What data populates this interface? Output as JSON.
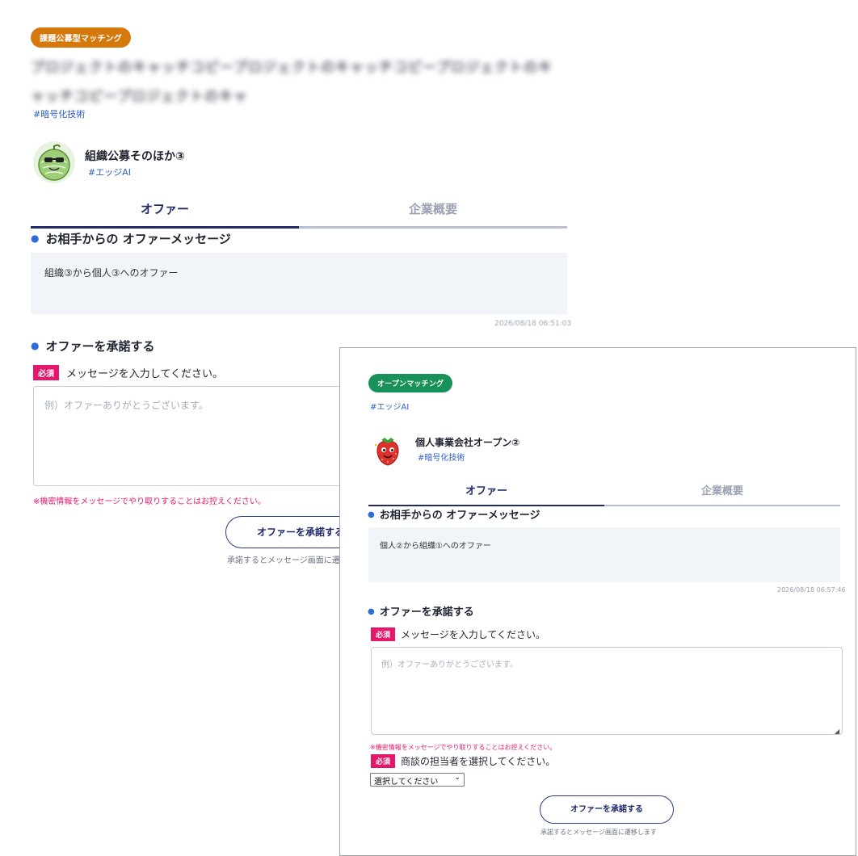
{
  "back": {
    "badge": "課題公募型マッチング",
    "blurred_title": "プロジェクトのキャッチコピープロジェクトのキャッチコピープロジェクトのキャッチコピープロジェクトのキャ",
    "tag": "#暗号化技術",
    "org_name": "組織公募そのほか③",
    "org_tag": "#エッジAI",
    "tabs": [
      "オファー",
      "企業概要"
    ],
    "section_message": "お相手からの オファーメッセージ",
    "message": "組織③から個人③へのオファー",
    "timestamp": "2026/08/18 06:51:03",
    "section_accept": "オファーを承諾する",
    "required": "必須",
    "input_label": "メッセージを入力してください。",
    "input_placeholder": "例）オファーありがとうございます。",
    "warning": "※機密情報をメッセージでやり取りすることはお控えください。",
    "accept_button": "オファーを承諾する",
    "accept_note": "承諾するとメッセージ画面に遷"
  },
  "front": {
    "badge": "オープンマッチング",
    "tag": "#エッジAI",
    "org_name": "個人事業会社オープン②",
    "org_tag": "#暗号化技術",
    "tabs": [
      "オファー",
      "企業概要"
    ],
    "section_message": "お相手からの オファーメッセージ",
    "message": "個人②から組織①へのオファー",
    "timestamp": "2026/08/18 06:57:46",
    "section_accept": "オファーを承諾する",
    "required": "必須",
    "input_label": "メッセージを入力してください。",
    "input_placeholder": "例）オファーありがとうございます。",
    "warning": "※機密情報をメッセージでやり取りすることはお控えください。",
    "select_label": "商談の担当者を選択してください。",
    "select_value": "選択してください",
    "accept_button": "オファーを承諾する",
    "accept_note": "承諾するとメッセージ画面に遷移します"
  },
  "colors": {
    "badge_orange": "#d6790c",
    "badge_green": "#19925a",
    "navy": "#1f2a6b",
    "link_blue": "#2b5cc9",
    "required_pink": "#e5176c"
  },
  "icons": [
    "melon-mascot-avatar-icon",
    "strawberry-mascot-avatar-icon",
    "chevron-down-icon",
    "bullet-dot-icon",
    "resize-handle-icon"
  ]
}
